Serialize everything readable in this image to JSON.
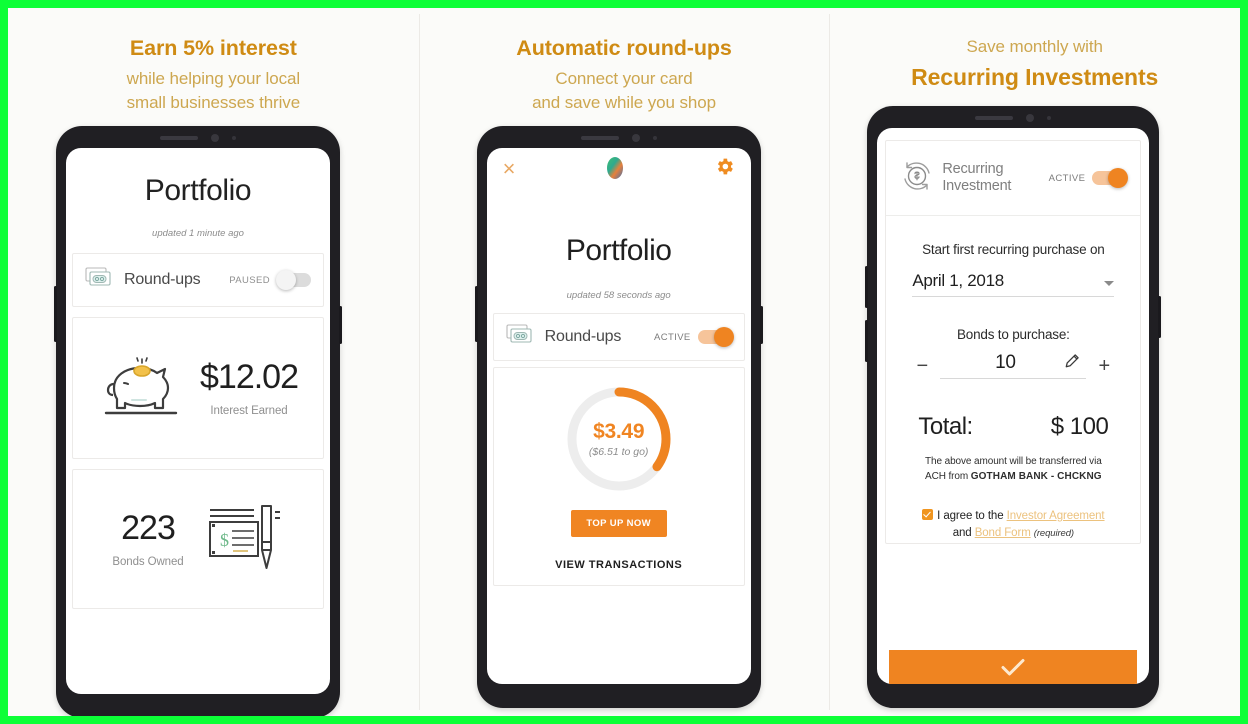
{
  "theme": {
    "border_color": "#0dff37",
    "page_bg": "#fbfbf9",
    "heading_bold_color": "#cf8b14",
    "heading_light_color": "#cda750",
    "accent_orange": "#ef8421",
    "toggle_on_track": "#f6c49a",
    "toggle_off_track": "#dcdcdc",
    "link_color": "#ecc27e"
  },
  "panels": [
    {
      "heading": {
        "line1": "Earn 5% interest",
        "line2": "while helping your local",
        "line3": "small businesses thrive"
      },
      "screen": {
        "title": "Portfolio",
        "updated": "updated 1 minute ago",
        "roundups": {
          "label": "Round-ups",
          "state": "PAUSED",
          "icon": "money-stack-icon"
        },
        "stats": [
          {
            "value": "$12.02",
            "caption": "Interest Earned",
            "icon": "piggy-bank-icon",
            "icon_side": "left"
          },
          {
            "value": "223",
            "caption": "Bonds Owned",
            "icon": "check-pen-icon",
            "icon_side": "right"
          }
        ]
      }
    },
    {
      "heading": {
        "line1": "Automatic round-ups",
        "line2": "Connect your card",
        "line3": "and save while you shop"
      },
      "screen": {
        "topbar": {
          "close": "×",
          "logo": "egg-logo-icon",
          "settings": "gear-icon"
        },
        "title": "Portfolio",
        "updated": "updated 58 seconds ago",
        "roundups": {
          "label": "Round-ups",
          "state": "ACTIVE",
          "icon": "money-stack-icon"
        },
        "ring": {
          "amount": "$3.49",
          "to_go": "($6.51 to go)",
          "progress_percent": 35,
          "track_color": "#ededed",
          "fill_color": "#ef8421"
        },
        "top_up_button": "TOP UP NOW",
        "view_transactions": "VIEW TRANSACTIONS"
      }
    },
    {
      "heading": {
        "line1": "Save monthly with",
        "line2": "Recurring Investments"
      },
      "screen": {
        "header": {
          "title_line1": "Recurring",
          "title_line2": "Investment",
          "state": "ACTIVE",
          "icon": "recurring-dollar-icon"
        },
        "date_label": "Start first recurring purchase on",
        "date_value": "April 1, 2018",
        "bonds_label": "Bonds to purchase:",
        "bonds_value": "10",
        "minus": "−",
        "plus": "+",
        "edit_icon": "pencil-icon",
        "total_label": "Total:",
        "total_value": "$ 100",
        "fineprint_line1": "The above amount will be transferred via",
        "fineprint_line2_prefix": "ACH from ",
        "fineprint_bank": "GOTHAM BANK - CHCKNG",
        "agree_prefix": "I agree to the ",
        "agree_link1": "Investor Agreement",
        "agree_middle": "and ",
        "agree_link2": "Bond Form",
        "agree_required": "(required)",
        "confirm": "checkmark-icon"
      }
    }
  ]
}
